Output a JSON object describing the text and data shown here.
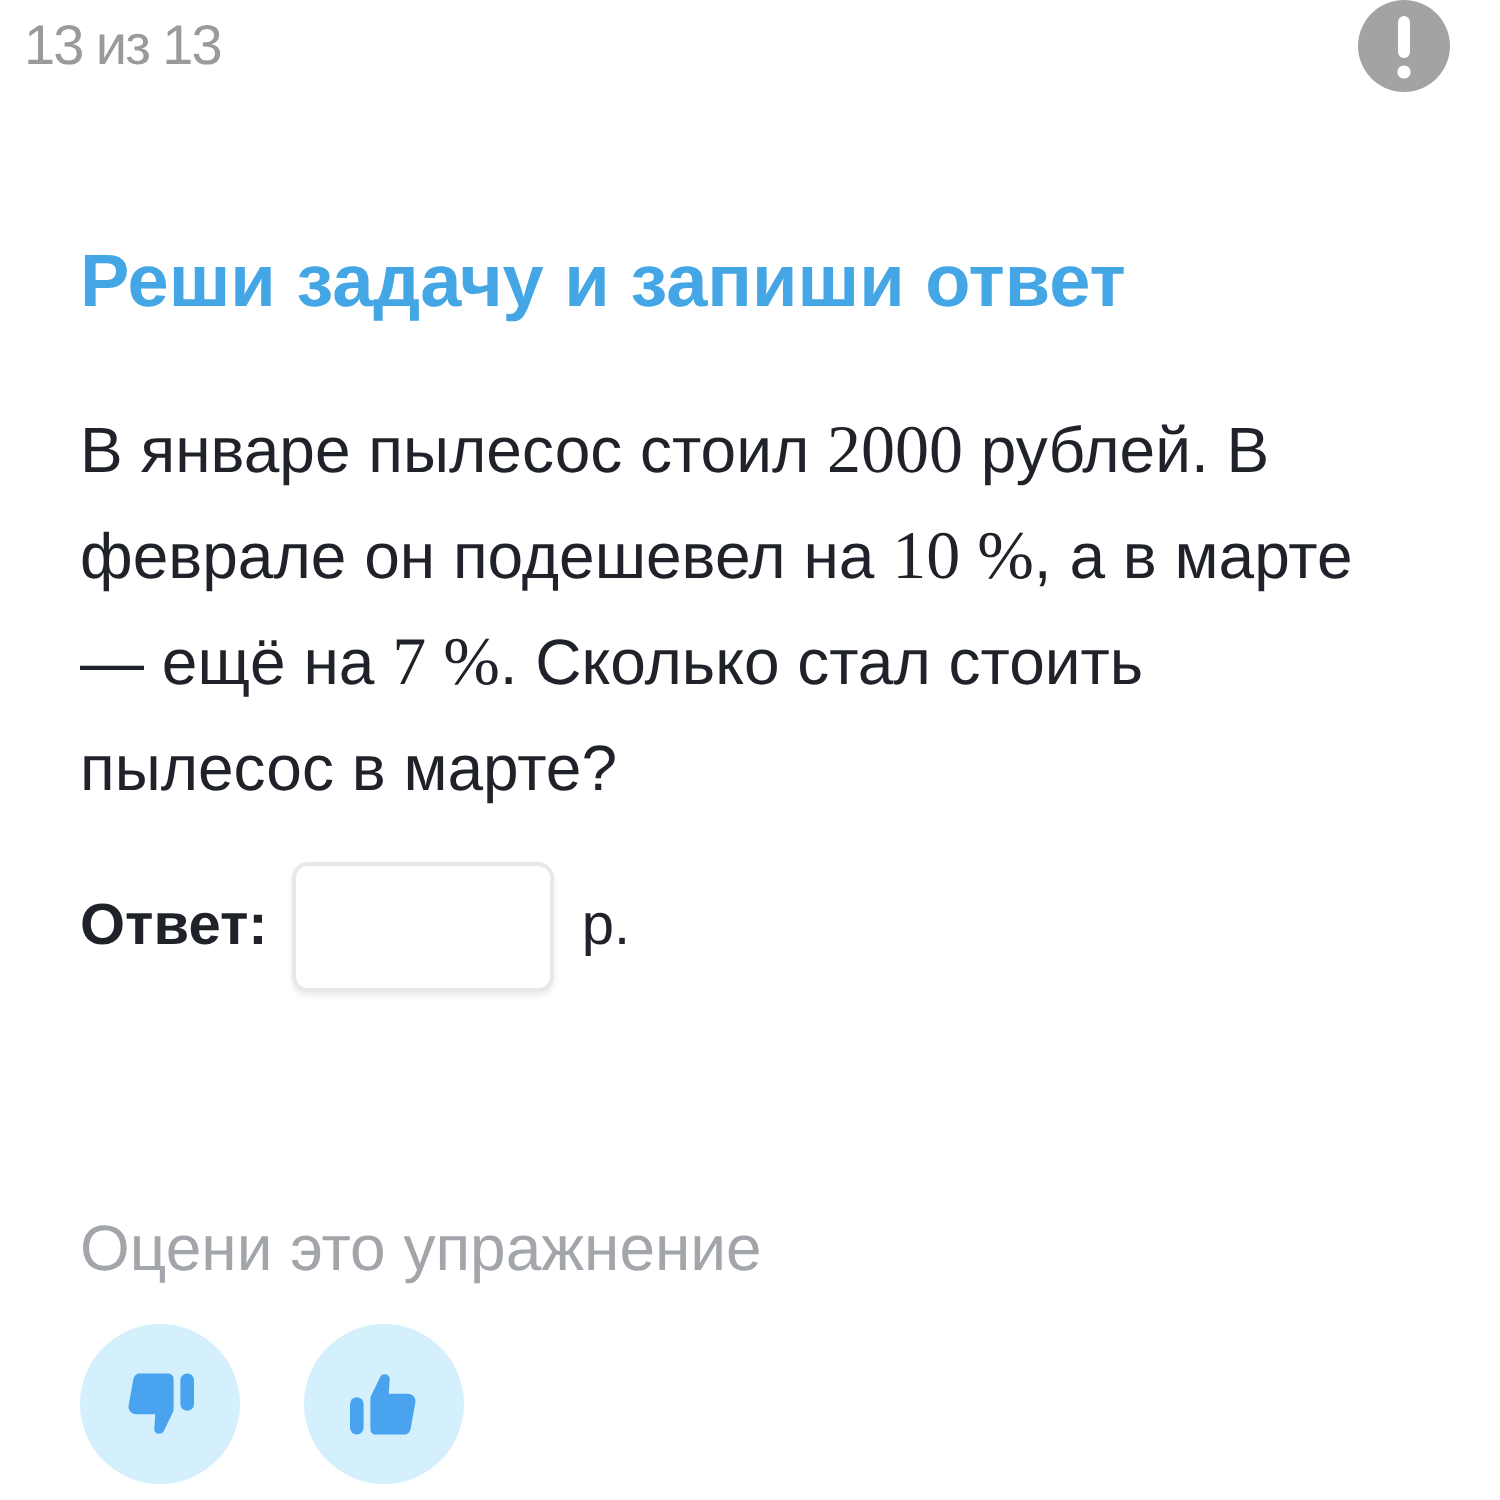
{
  "header": {
    "progress": "13 из 13"
  },
  "task": {
    "title": "Реши задачу и запиши ответ",
    "question": [
      {
        "kind": "text",
        "text": "В январе пылесос стоил "
      },
      {
        "kind": "math",
        "text": "2000"
      },
      {
        "kind": "text",
        "text": " рублей. В феврале он подешевел на "
      },
      {
        "kind": "math",
        "text": "10 %"
      },
      {
        "kind": "text",
        "text": ", а в марте — ещё на "
      },
      {
        "kind": "math",
        "text": "7 %"
      },
      {
        "kind": "text",
        "text": ". Сколько стал стоить пылесос в марте?"
      }
    ],
    "answer": {
      "label": "Ответ:",
      "unit": "р."
    }
  },
  "rating": {
    "label": "Оцени это упражнение"
  }
}
